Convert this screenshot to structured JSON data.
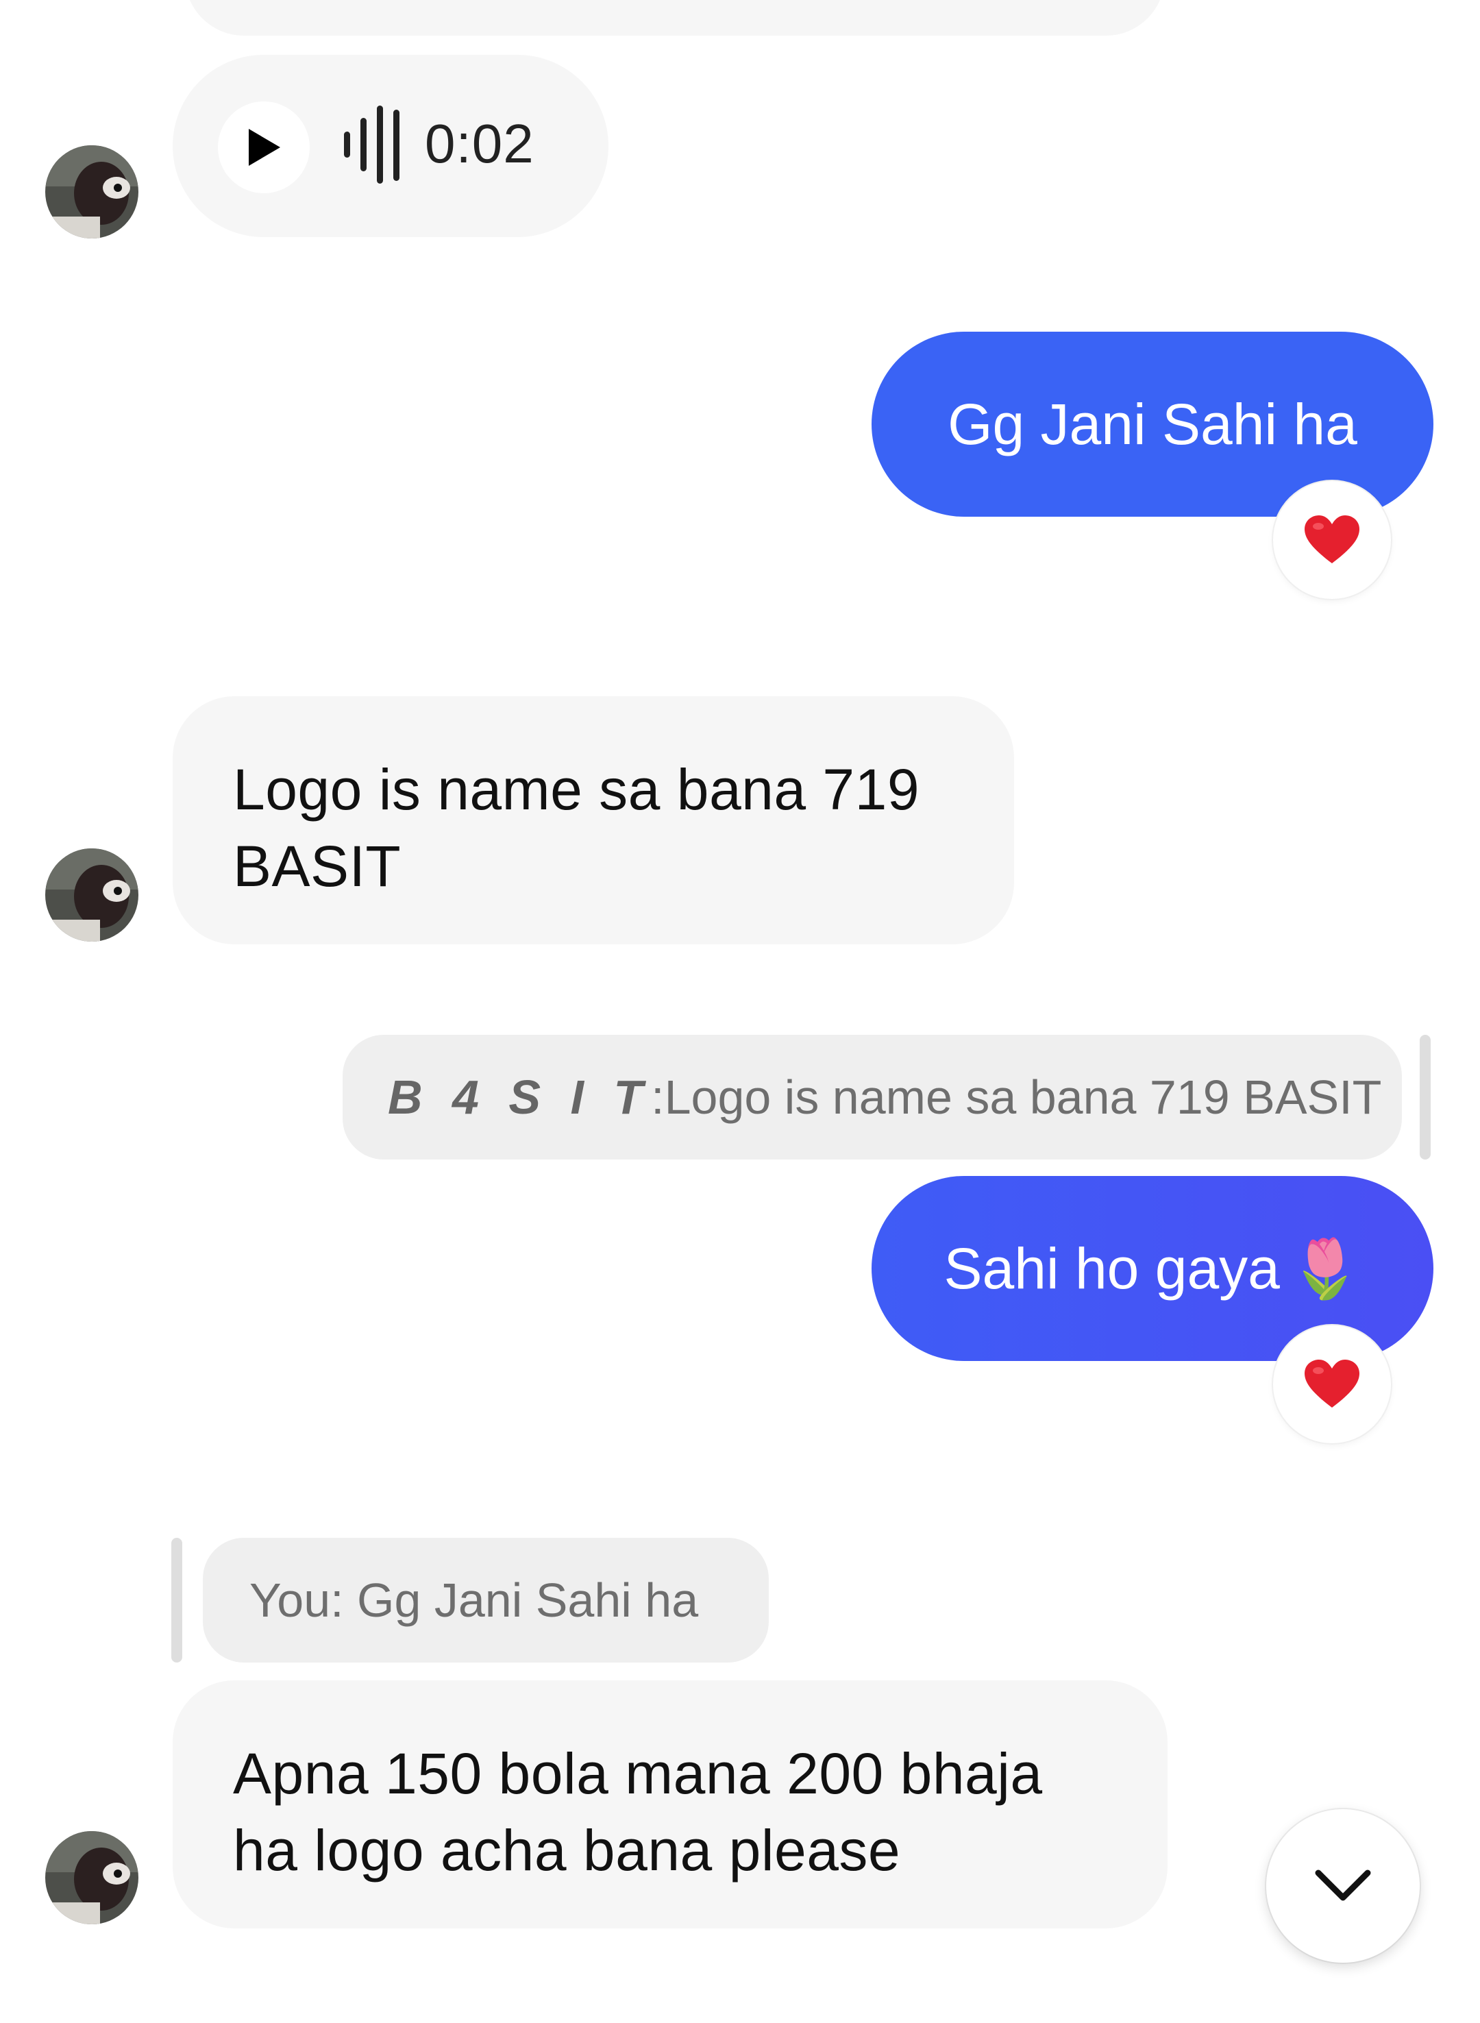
{
  "voice_message": {
    "duration": "0:02",
    "play_icon": "play-icon",
    "waveform_icon": "waveform-icon"
  },
  "messages": [
    {
      "direction": "sent",
      "text": "Gg Jani Sahi ha",
      "reaction": "❤️"
    },
    {
      "direction": "received",
      "lines": [
        "Logo is name sa bana 719",
        "BASIT"
      ]
    },
    {
      "direction": "sent",
      "reply_to": {
        "name": "B 4 S I T",
        "separator": ": ",
        "text": "Logo is name sa bana 719 BASIT"
      },
      "text": "Sahi ho gaya",
      "emoji": "🌷",
      "reaction": "❤️"
    },
    {
      "direction": "received",
      "reply_to": {
        "text": "You: Gg Jani Sahi ha"
      },
      "lines": [
        "Apna 150 bola mana 200 bhaja",
        "ha logo acha bana please"
      ]
    }
  ],
  "scroll_button": {
    "icon": "chevron-down-icon"
  },
  "colors": {
    "sent_bubble": "#3a63f5",
    "received_bubble": "#f6f6f6",
    "reaction_heart": "#e5202e"
  }
}
